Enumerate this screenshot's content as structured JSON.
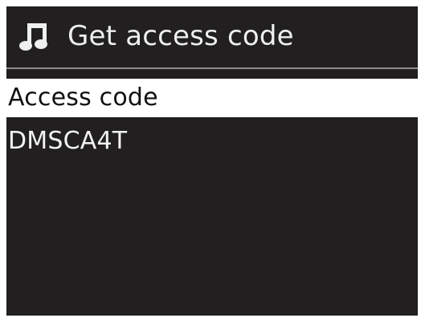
{
  "header": {
    "icon": "music-note-icon",
    "title": "Get access code"
  },
  "list": {
    "items": [
      {
        "label": "Access code",
        "selected": true
      },
      {
        "label": "DMSCA4T",
        "selected": false
      }
    ]
  },
  "colors": {
    "screen_bg": "#211f1f",
    "header_text": "#efefef",
    "highlight_bg": "#ffffff",
    "highlight_text": "#111111",
    "item_text": "#f2f2f2",
    "divider": "#8c8a8a"
  }
}
